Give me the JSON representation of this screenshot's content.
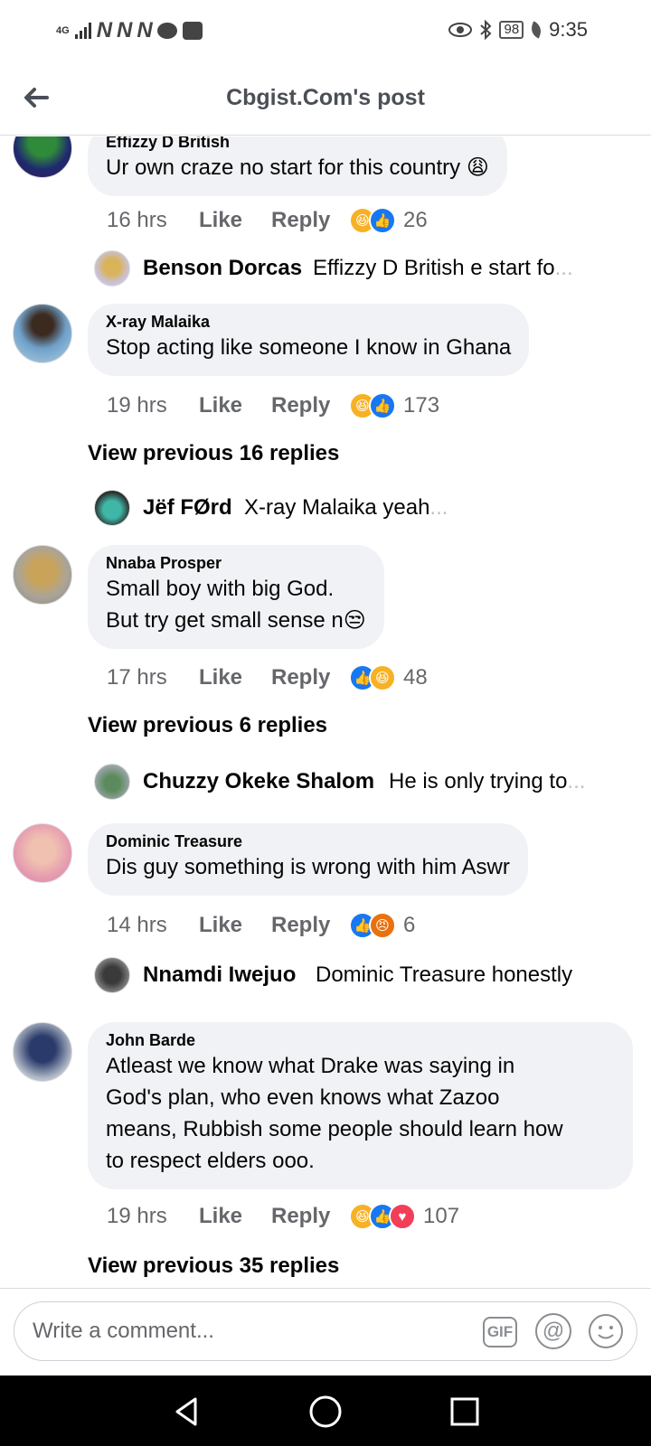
{
  "status": {
    "net": "4G",
    "battery": "98",
    "time": "9:35"
  },
  "header": {
    "title": "Cbgist.Com's post"
  },
  "comments": [
    {
      "name": "Effizzy D British",
      "lines": [
        "Ur own craze no start for this country 😩"
      ],
      "time": "16 hrs",
      "like": "Like",
      "reply": "Reply",
      "count": "26",
      "reply_preview": {
        "name": "Benson Dorcas",
        "text": "Effizzy D British e start fo",
        "ellipsis": "..."
      }
    },
    {
      "name": "X-ray Malaika",
      "lines": [
        "Stop acting like someone I know in Ghana"
      ],
      "time": "19 hrs",
      "like": "Like",
      "reply": "Reply",
      "count": "173",
      "view_prev": "View previous 16 replies",
      "reply_preview": {
        "name": "Jëf FØrd",
        "text": "X-ray Malaika yeah",
        "ellipsis": "..."
      }
    },
    {
      "name": "Nnaba Prosper",
      "lines": [
        "Small boy with big God.",
        "But try get small sense n😒"
      ],
      "time": "17 hrs",
      "like": "Like",
      "reply": "Reply",
      "count": "48",
      "view_prev": "View previous 6 replies",
      "reply_preview": {
        "name": "Chuzzy Okeke Shalom",
        "text": "He is only trying to",
        "ellipsis": "..."
      }
    },
    {
      "name": "Dominic Treasure",
      "lines": [
        "Dis guy something is wrong with him Aswr"
      ],
      "time": "14 hrs",
      "like": "Like",
      "reply": "Reply",
      "count": "6",
      "reply_preview": {
        "name": "Nnamdi Iwejuo",
        "text": "Dominic Treasure honestly",
        "ellipsis": ""
      }
    },
    {
      "name": "John Barde",
      "lines": [
        "Atleast we know what Drake was saying in",
        "God's plan, who even knows what Zazoo",
        "means, Rubbish some people should learn how",
        "to respect elders ooo."
      ],
      "time": "19 hrs",
      "like": "Like",
      "reply": "Reply",
      "count": "107",
      "view_prev": "View previous 35 replies"
    }
  ],
  "composer": {
    "placeholder": "Write a comment...",
    "gif": "GIF",
    "at": "@"
  },
  "colors": {
    "accent": "#1877f2",
    "bubble": "#f0f2f5",
    "muted": "#65676b"
  }
}
